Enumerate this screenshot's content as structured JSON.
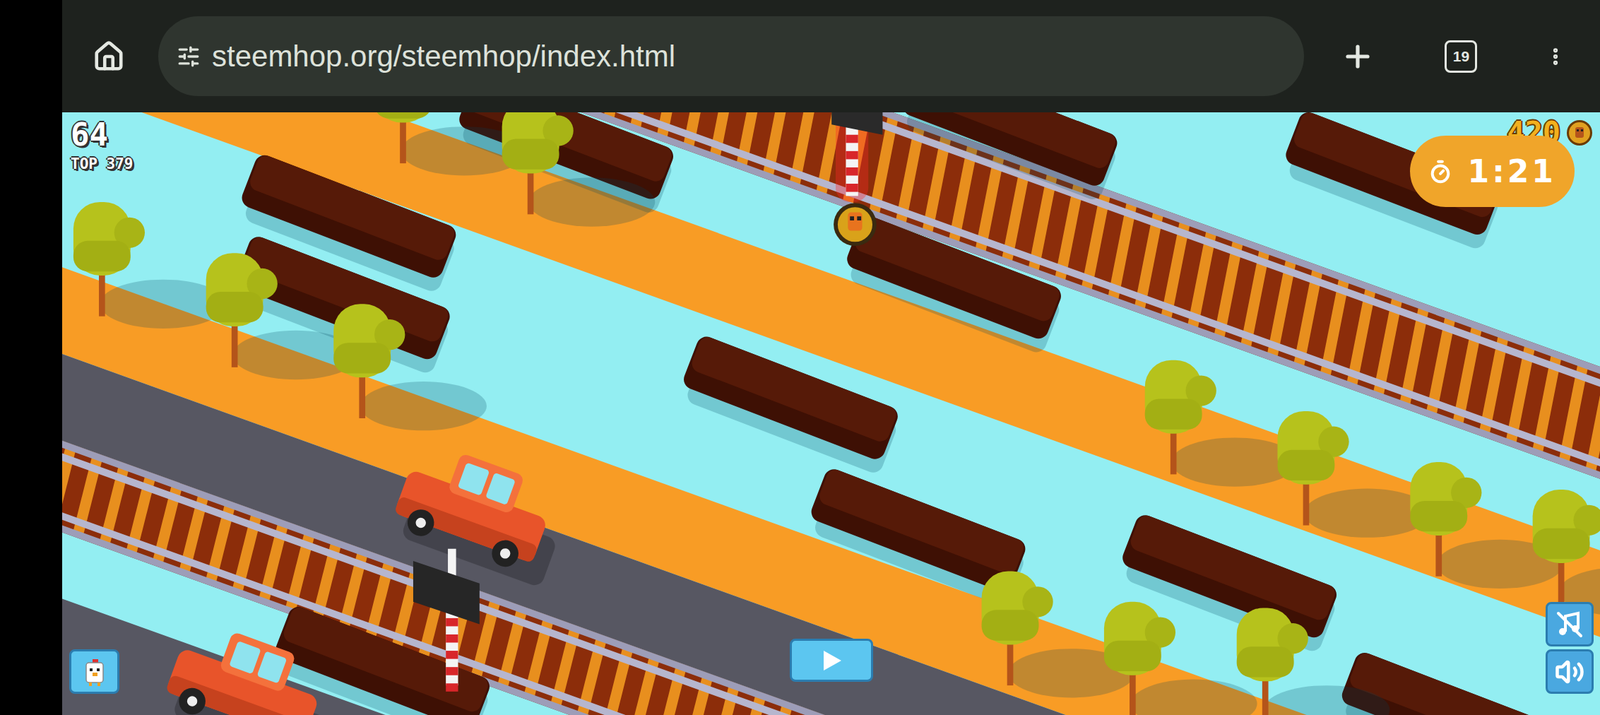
{
  "browser": {
    "url": "steemhop.org/steemhop/index.html",
    "tab_count": "19"
  },
  "game": {
    "score": "64",
    "top_score": "TOP 379",
    "coins": "420",
    "timer": "1:21"
  },
  "controls": {
    "music_on": false,
    "sound_on": true
  }
}
